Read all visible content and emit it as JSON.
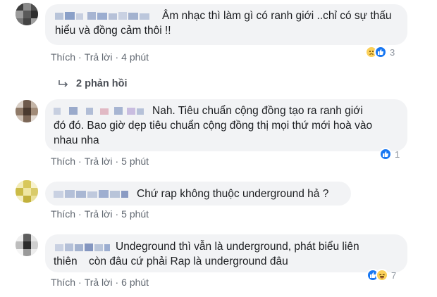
{
  "comments": [
    {
      "line1": "Âm nhạc thì làm gì có ranh giới ..chỉ có sự thấu",
      "line2": "hiểu và đồng cảm thôi !!",
      "line3": "",
      "actions": {
        "like": "Thích",
        "reply": "Trả lời",
        "time": "4 phút"
      },
      "reaction_count": "3",
      "reactions": [
        "sad-icon",
        "like-icon"
      ]
    },
    {
      "line1": "Nah. Tiêu chuẩn cộng đồng tạo ra ranh giới",
      "line2": "đó đó. Bao giờ dẹp tiêu chuẩn cộng đồng thị mọi thứ mới hoà vào",
      "line3": "nhau nha",
      "actions": {
        "like": "Thích",
        "reply": "Trả lời",
        "time": "5 phút"
      },
      "reaction_count": "1",
      "reactions": [
        "like-icon"
      ]
    },
    {
      "line1": "Chứ rap không thuộc underground hả ?",
      "line2": "",
      "line3": "",
      "actions": {
        "like": "Thích",
        "reply": "Trả lời",
        "time": "5 phút"
      },
      "reaction_count": "",
      "reactions": []
    },
    {
      "line1": "Undeground thì vẫn là underground, phát biểu liên",
      "line2": "thiên",
      "line2b": "còn đâu cứ phải Rap là underground đâu",
      "line3": "",
      "actions": {
        "like": "Thích",
        "reply": "Trả lời",
        "time": "6 phút"
      },
      "reaction_count": "7",
      "reactions": [
        "like-icon",
        "haha-icon"
      ]
    }
  ],
  "replies_link": "2 phản hồi",
  "colors": {
    "bubble": "#f2f3f5",
    "link": "#606770",
    "like": "#1877f2"
  }
}
